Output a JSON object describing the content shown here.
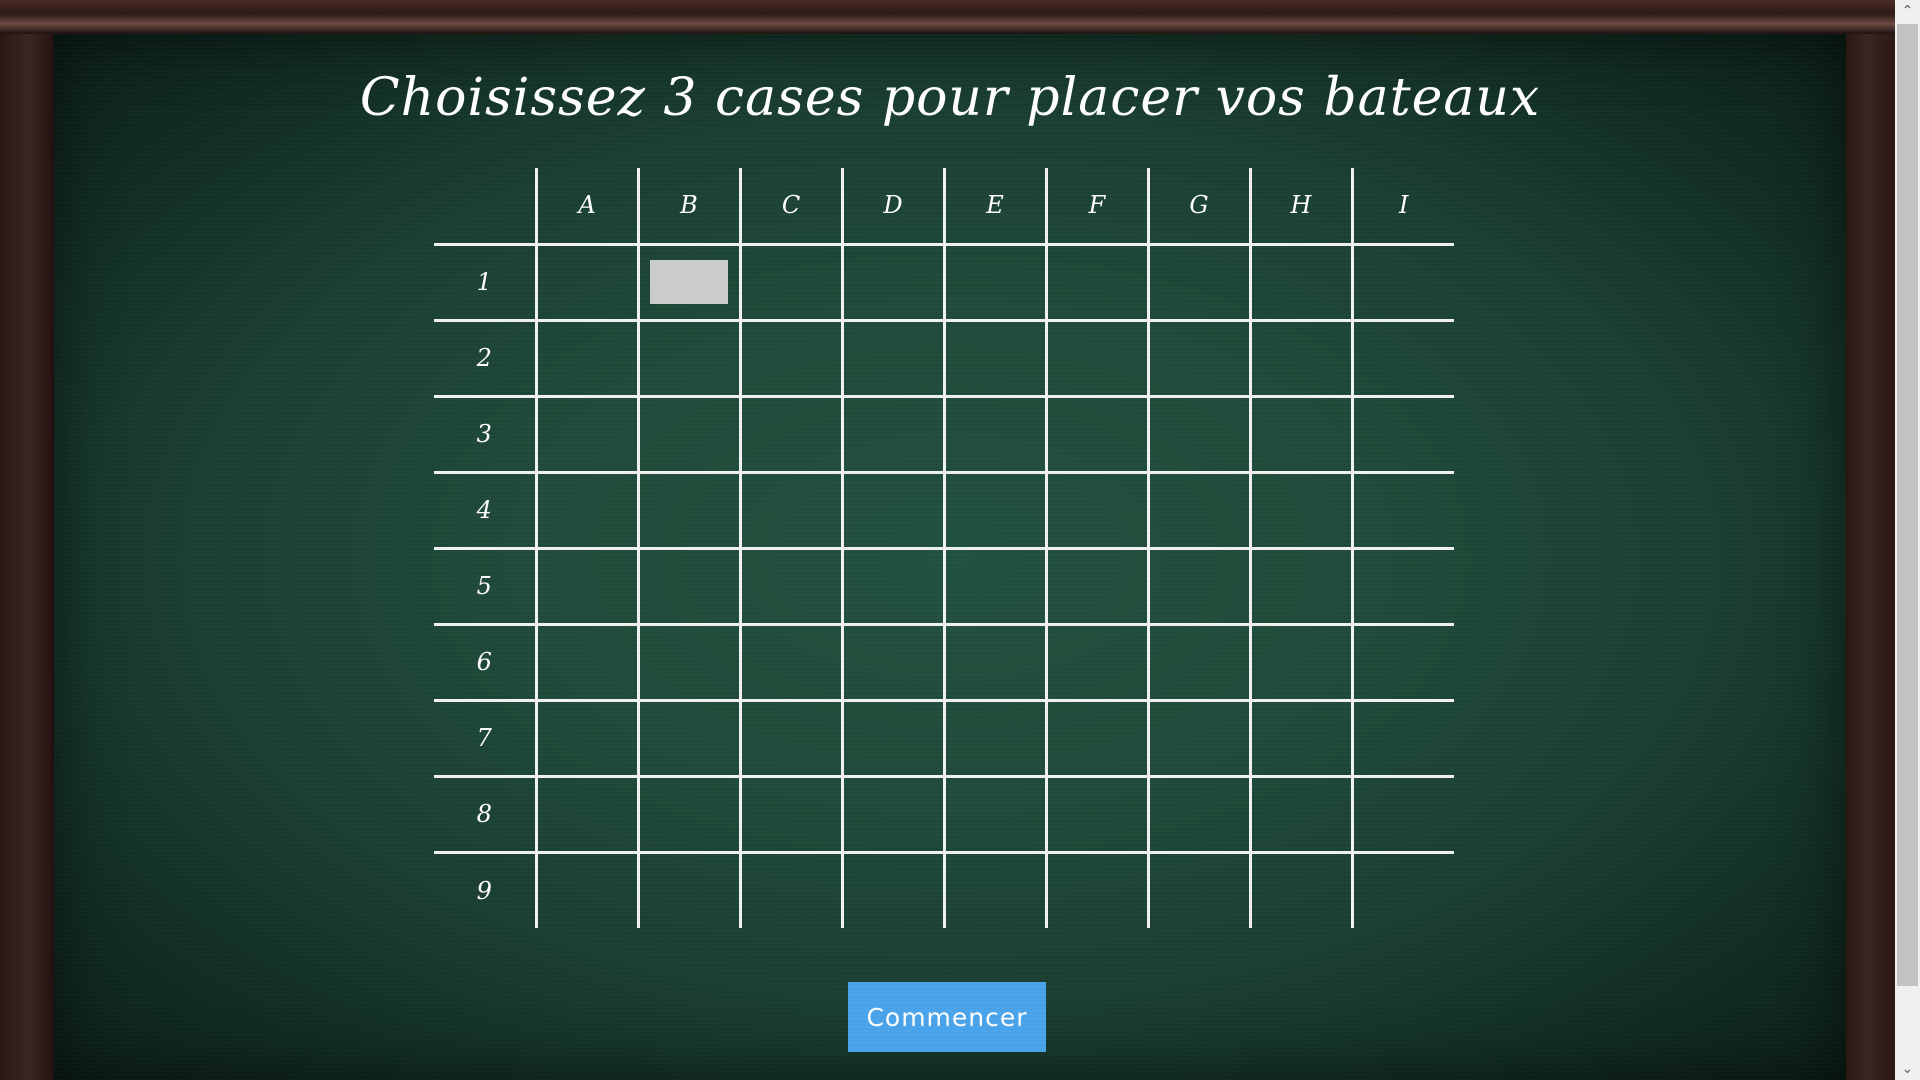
{
  "title": "Choisissez 3 cases pour placer vos bateaux",
  "grid": {
    "columns": [
      "A",
      "B",
      "C",
      "D",
      "E",
      "F",
      "G",
      "H",
      "I"
    ],
    "rows": [
      "1",
      "2",
      "3",
      "4",
      "5",
      "6",
      "7",
      "8",
      "9"
    ],
    "selected_cells": [
      {
        "row": "1",
        "col": "B"
      }
    ]
  },
  "start_button": {
    "label": "Commencer"
  },
  "colors": {
    "board": "#1f4a39",
    "grid_lines": "#f2f2f2",
    "selected_cell": "#cccccc",
    "button": "#4aa4ea",
    "frame": "#2e1a16"
  },
  "scrollbar": {
    "up_icon": "chevron-up-icon",
    "down_icon": "chevron-down-icon"
  }
}
